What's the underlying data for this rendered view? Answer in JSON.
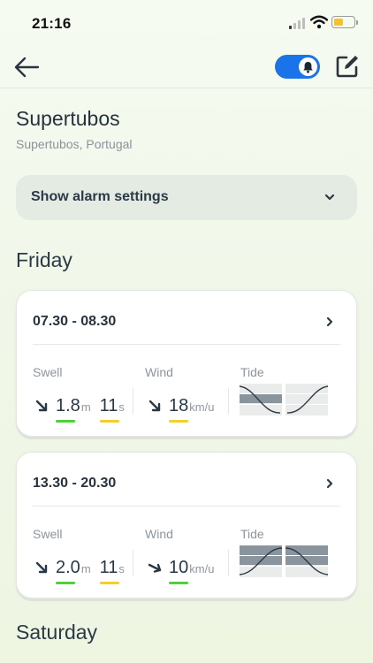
{
  "status_bar": {
    "time": "21:16"
  },
  "colors": {
    "accent": "#1a73e8",
    "good": "#4cd137",
    "fair": "#f5cf25",
    "tide_fill": "#8a949c"
  },
  "spot": {
    "name": "Supertubos",
    "location": "Supertubos, Portugal"
  },
  "alarm_settings": {
    "label": "Show alarm settings"
  },
  "days": [
    {
      "name": "Friday",
      "slots": [
        {
          "time": "07.30 - 08.30",
          "swell": {
            "label": "Swell",
            "height": "1.8",
            "height_unit": "m",
            "period": "11",
            "period_unit": "s",
            "height_rating": "good",
            "period_rating": "fair"
          },
          "wind": {
            "label": "Wind",
            "speed": "18",
            "unit": "km/u",
            "rating": "fair"
          },
          "tide": {
            "label": "Tide",
            "pattern": "high-low-high"
          }
        },
        {
          "time": "13.30 - 20.30",
          "swell": {
            "label": "Swell",
            "height": "2.0",
            "height_unit": "m",
            "period": "11",
            "period_unit": "s",
            "height_rating": "good",
            "period_rating": "fair"
          },
          "wind": {
            "label": "Wind",
            "speed": "10",
            "unit": "km/u",
            "rating": "good"
          },
          "tide": {
            "label": "Tide",
            "pattern": "low-high-low"
          }
        }
      ]
    },
    {
      "name": "Saturday",
      "slots": []
    }
  ]
}
